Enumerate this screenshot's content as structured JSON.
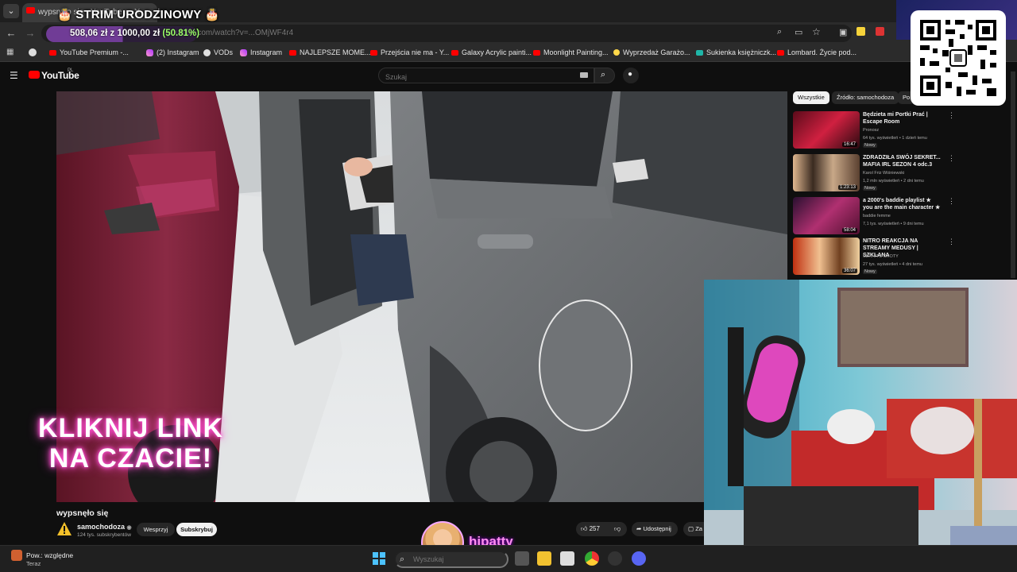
{
  "browser": {
    "tab_title": "wypsnęło się - YouTube",
    "url_faded": "youtube.com/watch?v=...OMjWF4r4",
    "bookmarks": [
      {
        "label": "YouTube Premium -...",
        "icon": "youtube-icon"
      },
      {
        "label": "(2) Instagram",
        "icon": "instagram-icon"
      },
      {
        "label": "VODs",
        "icon": "globe-icon"
      },
      {
        "label": "Instagram",
        "icon": "instagram-icon"
      },
      {
        "label": "NAJLEPSZE MOME...",
        "icon": "youtube-icon"
      },
      {
        "label": "Przejścia nie ma - Y...",
        "icon": "youtube-icon"
      },
      {
        "label": "Galaxy Acrylic painti...",
        "icon": "youtube-icon"
      },
      {
        "label": "Moonlight Painting...",
        "icon": "youtube-icon"
      },
      {
        "label": "Wyprzedaż Garażo...",
        "icon": "dot-icon"
      },
      {
        "label": "Sukienka księżniczk...",
        "icon": "vinted-icon"
      },
      {
        "label": "Lombard. Życie pod...",
        "icon": "youtube-icon"
      }
    ]
  },
  "stream_overlay": {
    "title": "🎂 STRIM URODZINOWY 🎂",
    "donation_text": "508,06 zł z 1000,00 zł",
    "donation_pct": "(50.81%)",
    "donation_progress": 0.5081,
    "caption_line1": "KLIKNIJ LINK",
    "caption_line2": "NA CZACIE!",
    "streamer_name": "hipatty"
  },
  "youtube": {
    "logo_text": "YouTube",
    "region": "PL",
    "search_placeholder": "Szukaj",
    "video_title": "wypsnęło się",
    "channel_name": "samochodoza",
    "channel_subs": "124 tys. subskrybentów",
    "support_label": "Wesprzyj",
    "subscribe_label": "Subskrybuj",
    "like_count": "257",
    "share_label": "Udostępnij",
    "save_label": "Za",
    "chips": [
      "Wszystkie",
      "Źródło: samochodoza",
      "Po"
    ],
    "recommendations": [
      {
        "title": "Będzieta mi Portki Prać | Escape Room",
        "channel": "Pronosz",
        "meta": "64 tys. wyświetleń • 1 dzień temu",
        "badge": "Nowy",
        "duration": "16:47"
      },
      {
        "title": "ZDRADZIŁA SWÓJ SEKRET... MAFIA IRL SEZON 4 odc.3",
        "channel": "Karol Friz Wiśniewski",
        "meta": "1,2 mln wyświetleń • 2 dni temu",
        "badge": "Nowy",
        "duration": "1:23:13"
      },
      {
        "title": "a 2000's baddie playlist ★ you are the main character ★",
        "channel": "baddie femme",
        "meta": "7,1 tys. wyświetleń • 9 dni temu",
        "badge": "",
        "duration": "58:04"
      },
      {
        "title": "NITRO REAKCJA NA STREAMY MEDUSY | SZKLANA",
        "channel": "SERHITO SHOTY",
        "meta": "27 tys. wyświetleń • 4 dni temu",
        "badge": "Nowy",
        "duration": "36:07"
      }
    ]
  },
  "taskbar": {
    "notif_title": "Pow.: względne",
    "notif_sub": "Teraz",
    "search_placeholder": "Wyszukaj"
  },
  "colors": {
    "yt_red": "#ff0000",
    "caption_glow": "#ff4fd0",
    "progress_green": "#9cff6a"
  }
}
